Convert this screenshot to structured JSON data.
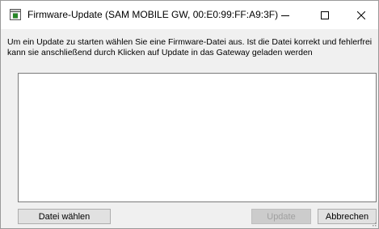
{
  "window": {
    "title": "Firmware-Update (SAM MOBILE GW, 00:E0:99:FF:A9:3F)",
    "app_icon": "firmware-chip-icon",
    "controls": [
      "minimize-icon",
      "maximize-icon",
      "close-icon"
    ]
  },
  "main": {
    "description": "Um ein Update zu starten wählen Sie eine Firmware-Datei aus. Ist die Datei korrekt und fehlerfrei kann sie anschließend durch Klicken auf Update in das Gateway geladen werden",
    "file_box_content": ""
  },
  "buttons": {
    "choose_file": "Datei wählen",
    "update": "Update",
    "cancel": "Abbrechen"
  },
  "colors": {
    "titlebar": "#ffffff",
    "dialog_background": "#f0f0f0",
    "button_face": "#e1e1e1",
    "disabled_text": "#a0a0a0",
    "icon_green": "#2e9d2e"
  }
}
